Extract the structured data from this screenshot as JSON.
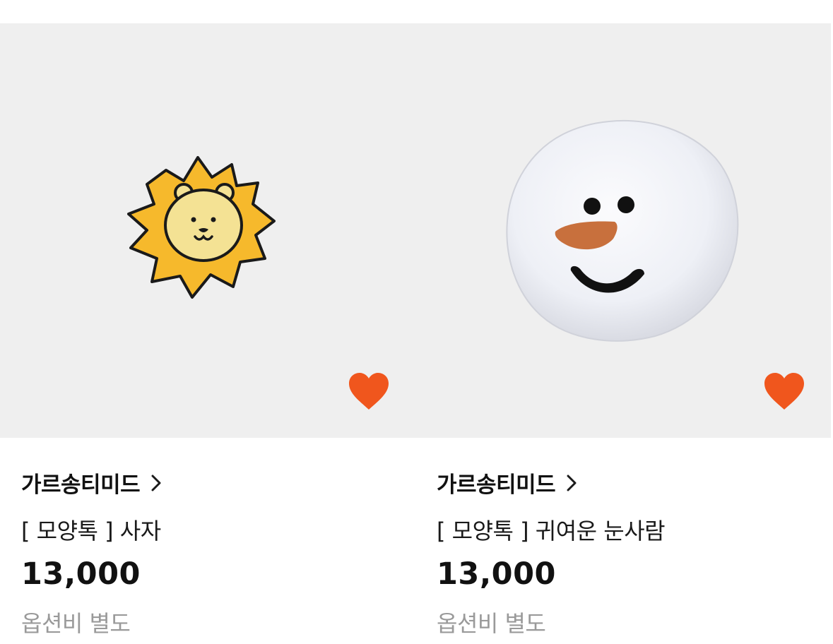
{
  "products": [
    {
      "brand": "가르송티미드",
      "title": "[ 모양톡 ] 사자",
      "price": "13,000",
      "option_note": "옵션비 별도",
      "image_icon": "lion-sticker-image",
      "favorite_icon": "heart-icon",
      "favorited": true
    },
    {
      "brand": "가르송티미드",
      "title": "[ 모양톡 ] 귀여운 눈사람",
      "price": "13,000",
      "option_note": "옵션비 별도",
      "image_icon": "snowman-sticker-image",
      "favorite_icon": "heart-icon",
      "favorited": true
    }
  ],
  "colors": {
    "thumb_bg": "#efefef",
    "heart": "#f0561d",
    "option_text": "#9a9a9a"
  }
}
